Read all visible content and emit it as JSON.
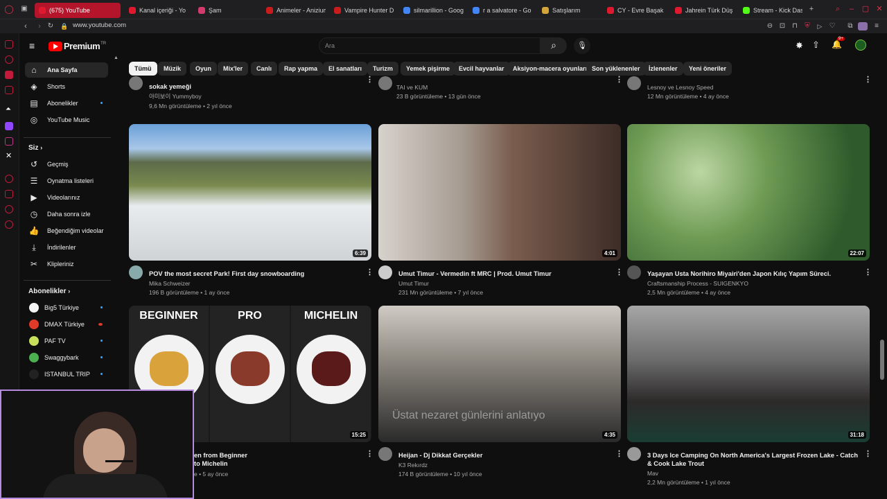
{
  "browser": {
    "tabs": [
      {
        "title": "(675) YouTube",
        "color": "#e01a2e"
      },
      {
        "title": "Kanal içeriği - Yo",
        "color": "#e01a2e"
      },
      {
        "title": "Şam",
        "color": "#d23b6b"
      },
      {
        "title": "Animeler - Anizium",
        "color": "#c91c1c"
      },
      {
        "title": "Vampire Hunter D",
        "color": "#c91c1c"
      },
      {
        "title": "silmarillion - Goog",
        "color": "#4285f4"
      },
      {
        "title": "r a salvatore - Go",
        "color": "#4285f4"
      },
      {
        "title": "Satışlarım",
        "color": "#d4a53a"
      },
      {
        "title": "CY - Evre Başak",
        "color": "#e01a2e"
      },
      {
        "title": "Jahrein Türk Düş",
        "color": "#e01a2e"
      },
      {
        "title": "Stream - Kick Das",
        "color": "#53fc18"
      }
    ],
    "url": "www.youtube.com"
  },
  "header": {
    "logo_text": "Premium",
    "logo_sup": "TR",
    "search_placeholder": "Ara",
    "notif_count": "9+"
  },
  "chips": [
    "Tümü",
    "Müzik",
    "Oyun",
    "Mix'ler",
    "Canlı",
    "Rap yapma",
    "El sanatları",
    "Turizm",
    "Yemek pişirme",
    "Evcil hayvanlar",
    "Aksiyon-macera oyunları",
    "Son yüklenenler",
    "İzlenenler",
    "Yeni öneriler"
  ],
  "sidebar": {
    "main": [
      {
        "label": "Ana Sayfa",
        "icon": "home-icon"
      },
      {
        "label": "Shorts",
        "icon": "shorts-icon"
      },
      {
        "label": "Abonelikler",
        "icon": "subscriptions-icon"
      },
      {
        "label": "YouTube Music",
        "icon": "music-icon"
      }
    ],
    "you_title": "Siz",
    "you": [
      {
        "label": "Geçmiş",
        "icon": "history-icon"
      },
      {
        "label": "Oynatma listeleri",
        "icon": "playlist-icon"
      },
      {
        "label": "Videolarınız",
        "icon": "video-icon"
      },
      {
        "label": "Daha sonra izle",
        "icon": "clock-icon"
      },
      {
        "label": "Beğendiğim videolar",
        "icon": "like-icon"
      },
      {
        "label": "İndirilenler",
        "icon": "download-icon"
      },
      {
        "label": "Klipleriniz",
        "icon": "scissors-icon"
      }
    ],
    "subs_title": "Abonelikler",
    "subs": [
      {
        "label": "Big5 Türkiye",
        "color": "#f5f5f5"
      },
      {
        "label": "DMAX Türkiye",
        "color": "#e03a2a"
      },
      {
        "label": "PAF TV",
        "color": "#c8e05a"
      },
      {
        "label": "Swaggybark",
        "color": "#4caf50"
      },
      {
        "label": "ISTANBUL TRIP",
        "color": "#222"
      }
    ]
  },
  "top_row": [
    {
      "title": "sokak yemeği",
      "channel": "야미보이 Yummyboy",
      "meta": "9,6 Mn görüntüleme • 2 yıl önce"
    },
    {
      "title": "",
      "channel": "TAI ve KUM",
      "meta": "23 B görüntüleme • 13 gün önce"
    },
    {
      "title": "",
      "channel": "Lesnoy ve Lesnoy Speed",
      "meta": "12 Mn görüntüleme • 4 ay önce"
    }
  ],
  "videos": [
    {
      "title": "POV the most secret Park! First day snowboarding",
      "channel": "Mika Schweizer",
      "meta": "196 B görüntüleme • 1 ay önce",
      "duration": "6:39",
      "avatar": "#8aa"
    },
    {
      "title": "Umut Timur - Vermedin ft MRC | Prod. Umut Timur",
      "channel": "Umut Timur",
      "meta": "231 Mn görüntüleme • 7 yıl önce",
      "duration": "4:01",
      "avatar": "#ccc"
    },
    {
      "title": "Yaşayan Usta Norihiro Miyairi'den Japon Kılıç Yapım Süreci.",
      "channel": "Craftsmanship Process - SUIGENKYO",
      "meta": "2,5 Mn görüntüleme • 4 ay önce",
      "duration": "22:07",
      "avatar": "#555"
    },
    {
      "title": "en from Beginner to Michelin",
      "channel": "",
      "meta": "e • 5 ay önce",
      "duration": "15:25",
      "labels": [
        "BEGINNER",
        "PRO",
        "MICHELIN"
      ]
    },
    {
      "title": "Heijan - Dj Dikkat Gerçekler",
      "channel": "K3 Rekırdz",
      "meta": "174 B görüntüleme • 10 yıl önce",
      "duration": "4:35",
      "avatar": "#777",
      "overlay": "Üstat nezaret günlerini anlatıyo"
    },
    {
      "title": "3 Days Ice Camping On North America's Largest Frozen Lake - Catch & Cook Lake Trout",
      "channel": "Mav",
      "meta": "2,2 Mn görüntüleme • 1 yıl önce",
      "duration": "31:18",
      "avatar": "#999"
    }
  ]
}
